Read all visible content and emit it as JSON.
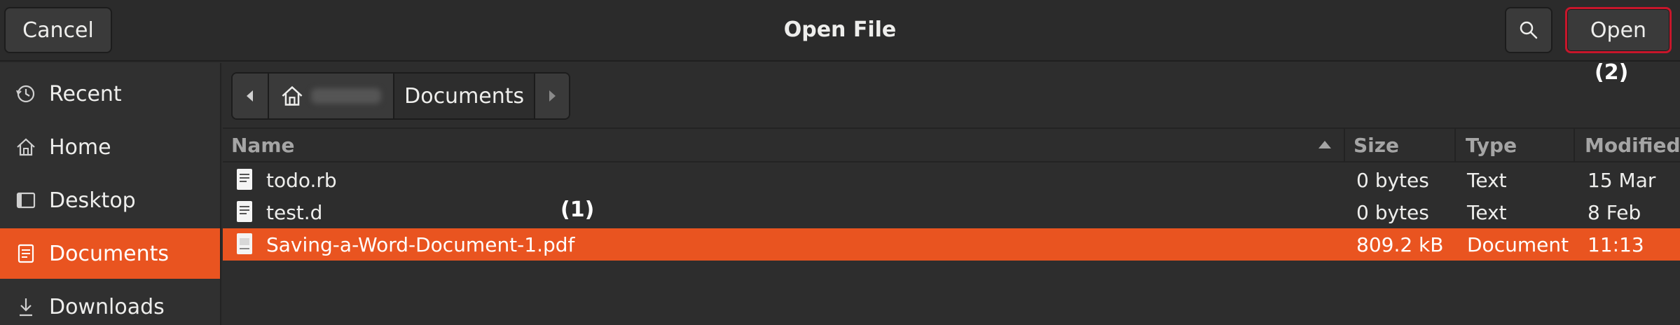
{
  "header": {
    "title": "Open File",
    "cancel_label": "Cancel",
    "open_label": "Open",
    "search_icon": "search-icon"
  },
  "annotations": {
    "one": "(1)",
    "two": "(2)"
  },
  "sidebar": {
    "items": [
      {
        "label": "Recent",
        "icon": "clock-icon"
      },
      {
        "label": "Home",
        "icon": "home-icon"
      },
      {
        "label": "Desktop",
        "icon": "desktop-icon"
      },
      {
        "label": "Documents",
        "icon": "document-icon",
        "active": true
      },
      {
        "label": "Downloads",
        "icon": "download-icon"
      }
    ]
  },
  "pathbar": {
    "current": "Documents"
  },
  "table": {
    "columns": [
      "Name",
      "Size",
      "Type",
      "Modified"
    ],
    "rows": [
      {
        "name": "todo.rb",
        "size": "0 bytes",
        "type": "Text",
        "modified": "15 Mar"
      },
      {
        "name": "test.d",
        "size": "0 bytes",
        "type": "Text",
        "modified": "8 Feb"
      },
      {
        "name": "Saving-a-Word-Document-1.pdf",
        "size": "809.2 kB",
        "type": "Document",
        "modified": "11:13",
        "selected": true
      }
    ]
  },
  "colors": {
    "accent": "#e95420",
    "open_outline": "#c7162b",
    "background": "#2d2d2d"
  }
}
